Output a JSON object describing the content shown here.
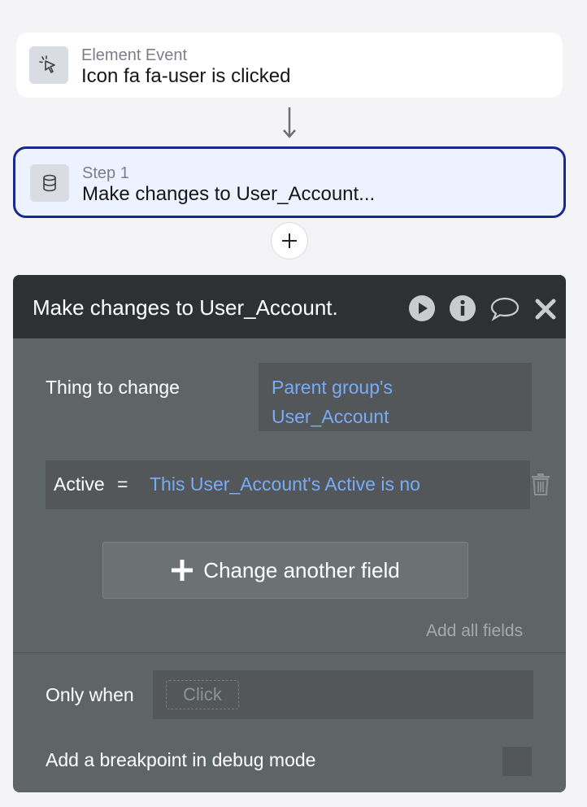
{
  "event": {
    "subtitle": "Element Event",
    "title": "Icon fa fa-user is clicked",
    "icon": "cursor-click-icon"
  },
  "step": {
    "subtitle": "Step 1",
    "title": "Make changes to User_Account...",
    "icon": "database-icon"
  },
  "panel": {
    "title": "Make changes to User_Account.",
    "header_icons": [
      "play-icon",
      "info-icon",
      "comment-icon",
      "close-icon"
    ],
    "thing_label": "Thing to change",
    "thing_value_line1": "Parent group's",
    "thing_value_line2": "User_Account",
    "field": {
      "name": "Active",
      "operator": "=",
      "value": "This User_Account's Active is no"
    },
    "change_button_label": "Change another field",
    "add_all_label": "Add all fields",
    "only_when_label": "Only when",
    "only_when_placeholder": "Click",
    "breakpoint_label": "Add a breakpoint in debug mode",
    "breakpoint_checked": false
  },
  "colors": {
    "accent_border": "#1a2a8c",
    "step_bg": "#ecf2ff",
    "panel_bg": "#5f6467",
    "panel_header_bg": "#2d3133",
    "link_blue": "#78acf5"
  }
}
